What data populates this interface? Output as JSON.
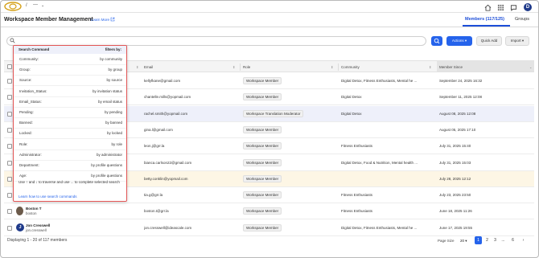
{
  "topbar": {
    "crumb_sep": "/",
    "crumb_dash": "---",
    "crumb_chevron": "⌄",
    "avatar_letter": "D",
    "icons": [
      "home-icon",
      "grid-icon",
      "chat-icon",
      "help-icon"
    ]
  },
  "header": {
    "title": "Workspace Member Management",
    "learn_more": "Learn More",
    "tabs": [
      {
        "label": "Members (117/125)",
        "active": true
      },
      {
        "label": "Groups",
        "active": false
      }
    ]
  },
  "toolbar": {
    "actions_label": "Actions ▾",
    "quick_add_label": "Quick Add",
    "import_label": "Import ▾"
  },
  "search_popup": {
    "header_left": "Search Command",
    "header_right": "filters by:",
    "commands": [
      {
        "key": "Community:",
        "desc": "by community"
      },
      {
        "key": "Group:",
        "desc": "by group"
      },
      {
        "key": "Source:",
        "desc": "by source"
      },
      {
        "key": "Invitation_Status:",
        "desc": "by invitation status"
      },
      {
        "key": "Email_Status:",
        "desc": "by email status"
      },
      {
        "key": "Pending:",
        "desc": "by pending"
      },
      {
        "key": "Banned:",
        "desc": "by banned"
      },
      {
        "key": "Locked:",
        "desc": "by locked"
      },
      {
        "key": "Role:",
        "desc": "by role"
      },
      {
        "key": "Administrator:",
        "desc": "by administrator"
      },
      {
        "key": "Department:",
        "desc": "by profile questions"
      },
      {
        "key": "Age:",
        "desc": "by profile questions"
      }
    ],
    "hint": "Use ↑ and ↓ to traverse and use ... to complete selected search",
    "link": "Learn how to use search commands"
  },
  "table": {
    "columns": [
      "Email",
      "Role",
      "Community",
      "Member Since"
    ],
    "sort_glyph": "⇕",
    "active_sort_glyph": "⌄",
    "rows": [
      {
        "name": "",
        "username": "",
        "email": "kellyfkane@gmail.com",
        "role": "Workspace Member",
        "community": "Digital Detox, Fitness Enthusiasts, Mental he ...",
        "since": "September 24, 2025 16:32",
        "highlight": ""
      },
      {
        "name": "",
        "username": "",
        "email": "chantelle.mills@yopmail.com",
        "role": "Workspace Member",
        "community": "Digital Detox",
        "since": "September 11, 2025 12:08",
        "highlight": ""
      },
      {
        "name": "",
        "username": "",
        "email": "rachel.smith@yopmail.com",
        "role": "Workspace Translation Moderator",
        "community": "Digital Detox",
        "since": "August 08, 2025 12:08",
        "highlight": "blue"
      },
      {
        "name": "",
        "username": "",
        "email": "gina.l@gmail.com",
        "role": "Workspace Member",
        "community": "",
        "since": "August 05, 2025 17:10",
        "highlight": ""
      },
      {
        "name": "",
        "username": "",
        "email": "leon.j@grr.la",
        "role": "Workspace Member",
        "community": "Fitness Enthusiasts",
        "since": "July 31, 2025 15:40",
        "highlight": ""
      },
      {
        "name": "",
        "username": "",
        "email": "bianca.carlson22@gmail.com",
        "role": "Workspace Member",
        "community": "Digital Detox, Food & Nutrition, Mental health ...",
        "since": "July 31, 2025 15:03",
        "highlight": ""
      },
      {
        "name": "",
        "username": "",
        "email": "betty.conklin@yopmail.com",
        "role": "Workspace Member",
        "community": "",
        "since": "July 28, 2025 12:12",
        "highlight": "yellow"
      },
      {
        "name": "",
        "username": "",
        "email": "tia.g@grr.la",
        "role": "Workspace Member",
        "community": "Fitness Enthusiasts",
        "since": "July 23, 2025 23:50",
        "highlight": ""
      },
      {
        "name": "Boston T",
        "username": "boston",
        "email": "boston.t@grr.la",
        "role": "Workspace Member",
        "community": "Fitness Enthusiasts",
        "since": "June 18, 2025 11:26",
        "highlight": ""
      },
      {
        "name": "Jon Cresswell",
        "username": "jon.cresswell",
        "email": "jon.cresswell@ideascale.com",
        "role": "Workspace Member",
        "community": "Digital Detox, Fitness Enthusiasts, Mental he ...",
        "since": "June 17, 2025 19:55",
        "highlight": ""
      }
    ]
  },
  "footer": {
    "summary": "Displaying 1 - 20 of 117 members",
    "page_size_label": "Page Size",
    "page_size_value": "20 ▾",
    "pages": [
      "1",
      "2",
      "3",
      "...",
      "6",
      "›"
    ],
    "active_page": "1"
  },
  "colors": {
    "accent": "#2563eb",
    "popup_border": "#e25555",
    "row_highlight_blue": "#eef0fa",
    "row_highlight_yellow": "#fdf6e5"
  }
}
